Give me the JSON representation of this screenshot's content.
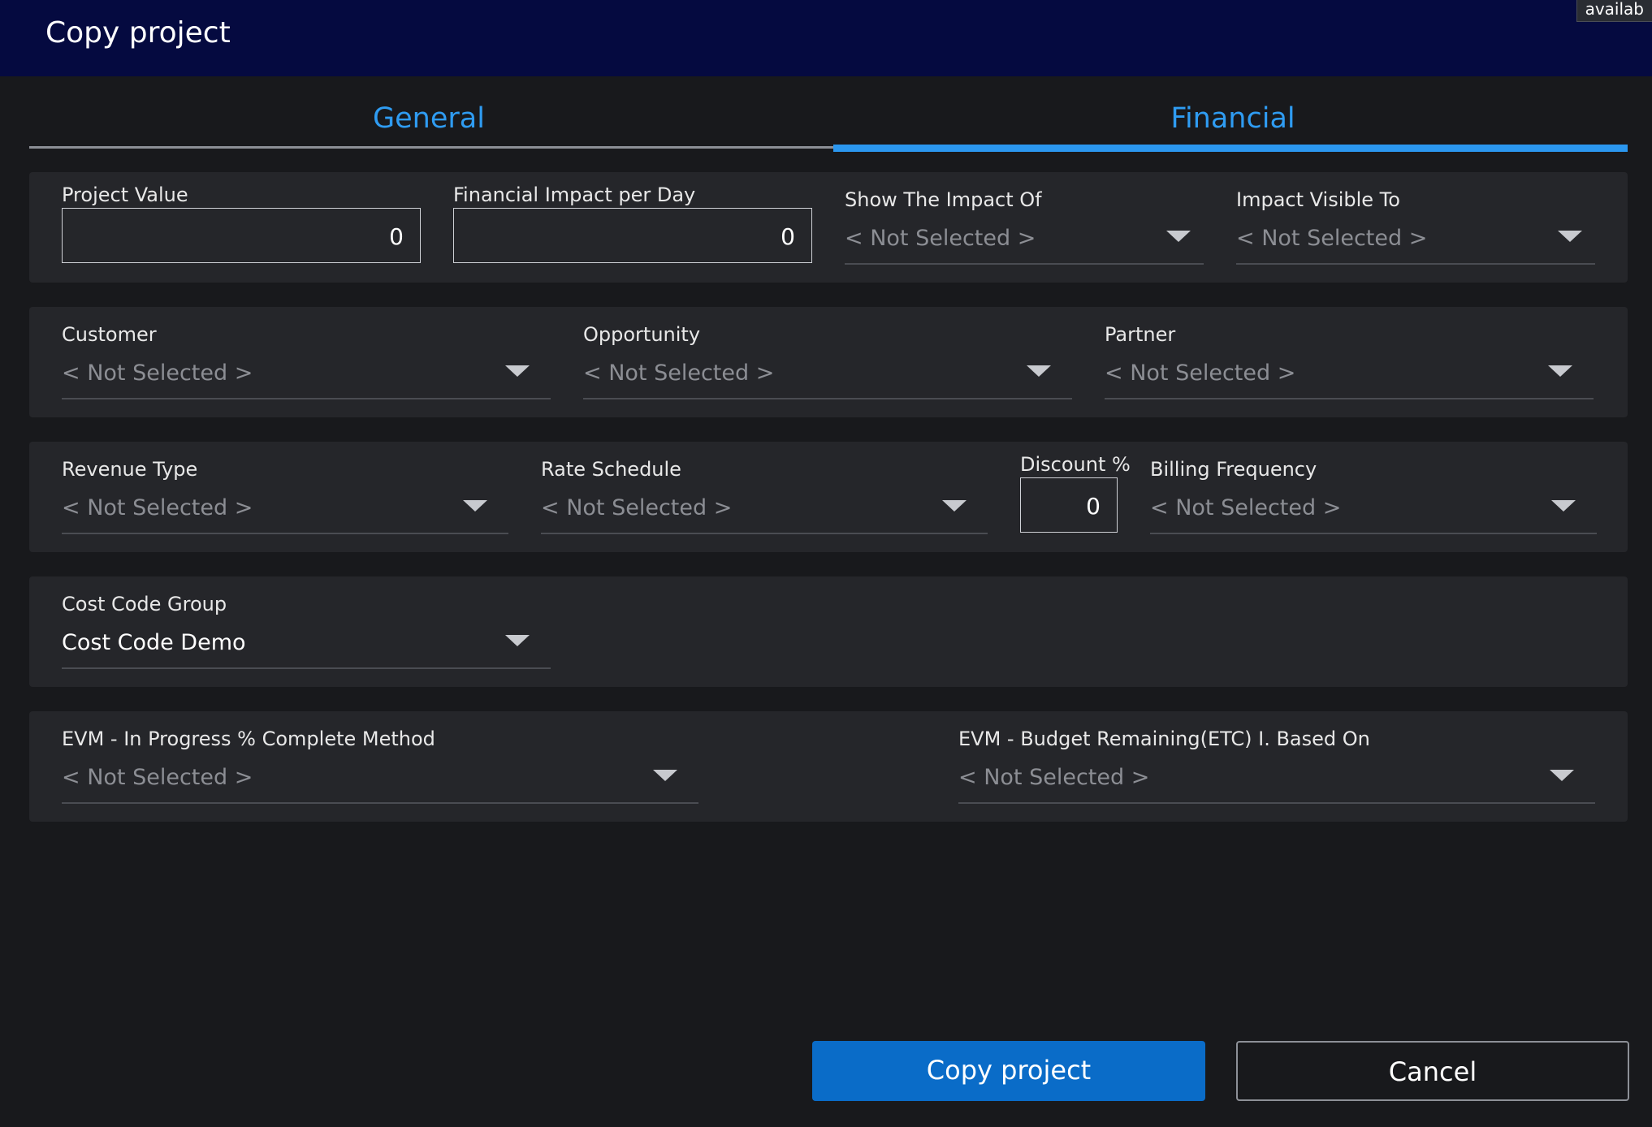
{
  "window": {
    "title": "Copy project",
    "corner_tag": "availab"
  },
  "tabs": [
    {
      "label": "General",
      "active": false
    },
    {
      "label": "Financial",
      "active": true
    }
  ],
  "fields": {
    "project_value": {
      "label": "Project Value",
      "value": "0"
    },
    "financial_impact_per_day": {
      "label": "Financial Impact per Day",
      "value": "0"
    },
    "show_the_impact_of": {
      "label": "Show The Impact Of",
      "value": "< Not Selected >"
    },
    "impact_visible_to": {
      "label": "Impact Visible To",
      "value": "< Not Selected >"
    },
    "customer": {
      "label": "Customer",
      "value": "< Not Selected >"
    },
    "opportunity": {
      "label": "Opportunity",
      "value": "< Not Selected >"
    },
    "partner": {
      "label": "Partner",
      "value": "< Not Selected >"
    },
    "revenue_type": {
      "label": "Revenue Type",
      "value": "< Not Selected >"
    },
    "rate_schedule": {
      "label": "Rate Schedule",
      "value": "< Not Selected >"
    },
    "discount_pct": {
      "label": "Discount %",
      "value": "0"
    },
    "billing_frequency": {
      "label": "Billing Frequency",
      "value": "< Not Selected >"
    },
    "cost_code_group": {
      "label": "Cost Code Group",
      "value": "Cost Code Demo"
    },
    "evm_in_progress": {
      "label": "EVM - In Progress % Complete Method",
      "value": "< Not Selected >"
    },
    "evm_budget_remaining": {
      "label": "EVM - Budget Remaining(ETC) I. Based On",
      "value": "< Not Selected >"
    }
  },
  "actions": {
    "copy_label": "Copy project",
    "cancel_label": "Cancel"
  },
  "colors": {
    "titlebar_bg": "#050a40",
    "accent": "#2b97ef",
    "primary_button": "#0a6cc8",
    "panel_bg": "#25262a",
    "page_bg": "#18191c"
  }
}
